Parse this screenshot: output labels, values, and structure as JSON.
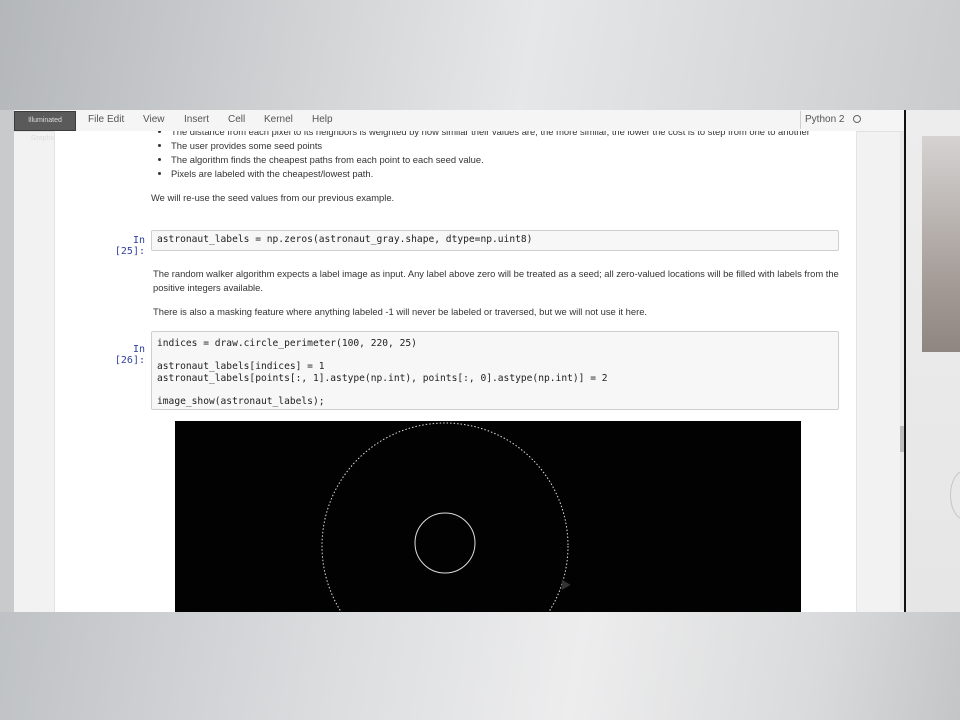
{
  "menubar": {
    "notification": "Illuminated Graphics",
    "items": [
      "File",
      "Edit",
      "View",
      "Insert",
      "Cell",
      "Kernel",
      "Help"
    ],
    "kernel": "Python 2"
  },
  "markdown_top": {
    "bullets": [
      "The distance from each pixel to its neighbors is weighted by how similar their values are; the more similar, the lower the cost is to step from one to another",
      "The user provides some seed points",
      "The algorithm finds the cheapest paths from each point to each seed value.",
      "Pixels are labeled with the cheapest/lowest path."
    ],
    "para": "We will re-use the seed values from our previous example."
  },
  "cell25": {
    "prompt": "In [25]:",
    "code": "astronaut_labels = np.zeros(astronaut_gray.shape, dtype=np.uint8)"
  },
  "markdown_mid": {
    "para1": "The random walker algorithm expects a label image as input. Any label above zero will be treated as a seed; all zero-valued locations will be filled with labels from the positive integers available.",
    "para2": "There is also a masking feature where anything labeled -1 will never be labeled or traversed, but we will not use it here."
  },
  "cell26": {
    "prompt": "In [26]:",
    "code": "indices = draw.circle_perimeter(100, 220, 25)\n\nastronaut_labels[indices] = 1\nastronaut_labels[points[:, 1].astype(np.int), points[:, 0].astype(np.int)] = 2\n\nimage_show(astronaut_labels);"
  },
  "colors": {
    "prompt": "#303f9f",
    "output_bg": "#020202",
    "circle": "#dddddd"
  }
}
